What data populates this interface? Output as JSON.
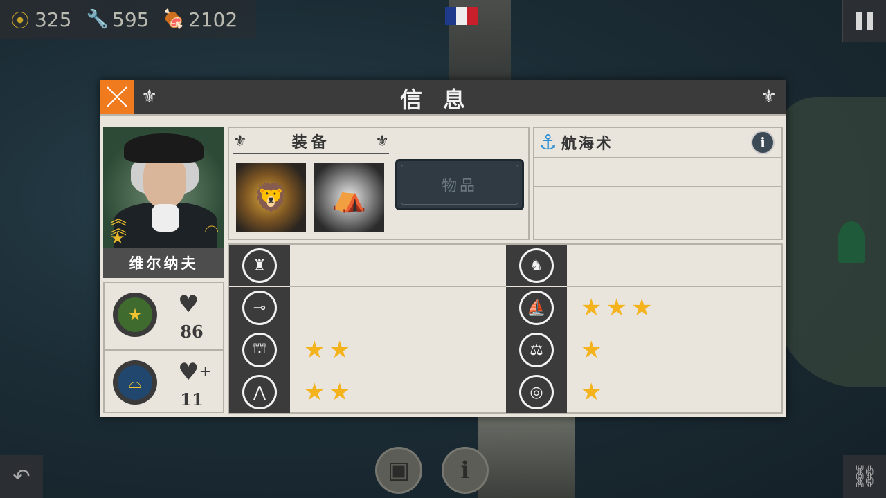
{
  "resources": {
    "gold": "325",
    "tools": "595",
    "food": "2102"
  },
  "dialog": {
    "title": "信息",
    "close_icon": "close-x-icon"
  },
  "officer": {
    "name": "维尔纳夫",
    "health": "86",
    "regen": "11"
  },
  "equipment": {
    "header": "装备",
    "items_button": "物品",
    "slots": [
      "figurehead-lion",
      "army-camp-tents"
    ]
  },
  "navigation": {
    "title": "航海术",
    "info": "i"
  },
  "skills": [
    {
      "icon": "infantry-icon",
      "stars": 0
    },
    {
      "icon": "cavalry-icon",
      "stars": 0
    },
    {
      "icon": "artillery-icon",
      "stars": 0
    },
    {
      "icon": "ship-icon",
      "stars": 3
    },
    {
      "icon": "fortification-icon",
      "stars": 2
    },
    {
      "icon": "scales-icon",
      "stars": 1
    },
    {
      "icon": "march-icon",
      "stars": 2
    },
    {
      "icon": "target-icon",
      "stars": 1
    }
  ],
  "colors": {
    "close_orange": "#f07a1e",
    "star_gold": "#f4b21c",
    "panel_bg": "#e9e5dd",
    "header_dark": "#3b3b3b",
    "anchor_blue": "#2b8fd6"
  }
}
